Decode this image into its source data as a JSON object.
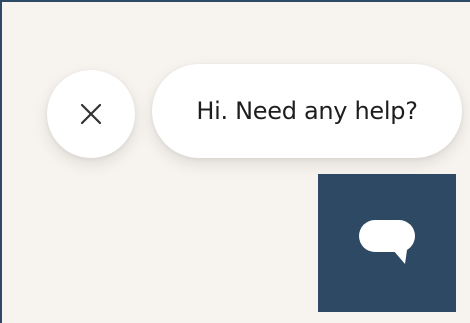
{
  "greeting": {
    "message": "Hi. Need any help?"
  },
  "icons": {
    "close": "close-icon",
    "chat": "chat-bubble-icon"
  },
  "colors": {
    "background": "#f7f3ee",
    "launcher": "#2e4964",
    "bubble": "#ffffff",
    "text": "#1e1e1e"
  }
}
